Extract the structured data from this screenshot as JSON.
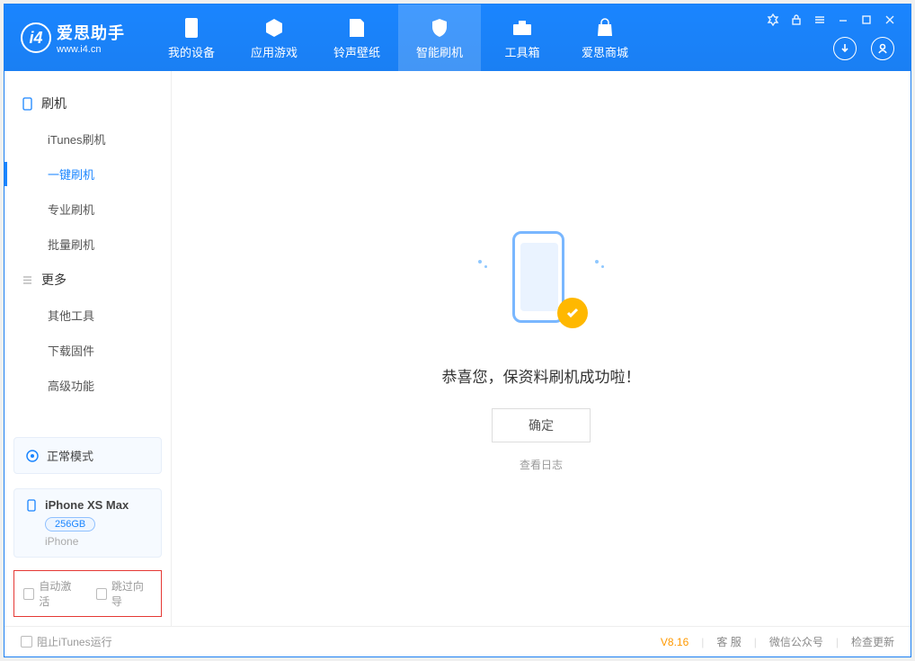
{
  "app": {
    "name_cn": "爱思助手",
    "url": "www.i4.cn"
  },
  "topnav": {
    "my_device": "我的设备",
    "apps_games": "应用游戏",
    "ring_wall": "铃声壁纸",
    "smart_flash": "智能刷机",
    "toolbox": "工具箱",
    "store": "爱思商城"
  },
  "sidebar": {
    "group_flash": "刷机",
    "itunes_flash": "iTunes刷机",
    "one_key_flash": "一键刷机",
    "pro_flash": "专业刷机",
    "batch_flash": "批量刷机",
    "group_more": "更多",
    "other_tools": "其他工具",
    "download_fw": "下载固件",
    "advanced": "高级功能"
  },
  "mode": {
    "label": "正常模式"
  },
  "device": {
    "name": "iPhone XS Max",
    "capacity": "256GB",
    "type": "iPhone"
  },
  "checks": {
    "auto_activate": "自动激活",
    "skip_guide": "跳过向导"
  },
  "main": {
    "success": "恭喜您，保资料刷机成功啦！",
    "ok": "确定",
    "view_log": "查看日志"
  },
  "status": {
    "block_itunes": "阻止iTunes运行",
    "version": "V8.16",
    "support": "客 服",
    "wechat": "微信公众号",
    "update": "检查更新"
  }
}
